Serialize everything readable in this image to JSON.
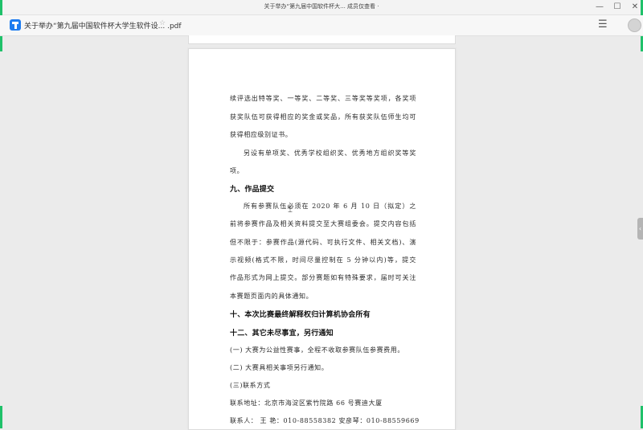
{
  "window": {
    "title": "关于举办“第九届中国软件杯大... 成员仅查看 ·",
    "controls": {
      "minimize": "—",
      "maximize": "☐",
      "close": "✕"
    }
  },
  "tab": {
    "doc_title": "关于举办“第九届中国软件杯大学生软件设... .pdf",
    "star": "☆",
    "menu": "☰"
  },
  "document": {
    "lines": [
      "续评选出特等奖、一等奖、二等奖、三等奖等奖项，各奖项",
      "获奖队伍可获得相应的奖金或奖品，所有获奖队伍师生均可",
      "获得相应级别证书。",
      "另设有单项奖、优秀学校组织奖、优秀地方组织奖等奖",
      "项。",
      "九、作品提交",
      "所有参赛队伍必须在 2020 年 6 月 10 日（拟定）之",
      "前将参赛作品及相关资料提交至大赛组委会。提交内容包括",
      "但不限于：参赛作品(源代码、可执行文件、相关文档)、演",
      "示视频(格式不限，时间尽量控制在 5 分钟以内)等，提交",
      "作品形式为网上提交。部分赛题如有特殊要求，届时可关注",
      "本赛题页面内的具体通知。",
      "十、本次比赛最终解释权归计算机协会所有",
      "十二、其它未尽事宜，另行通知",
      "(一) 大赛为公益性赛事，全程不收取参赛队伍参赛费用。",
      "(二) 大赛具相关事项另行通知。",
      "(三)联系方式",
      "联系地址：北京市海淀区紫竹院路 66 号赛迪大厦",
      "联系人：  王  艳：010-88558382  安彦琴：010-88559669"
    ]
  },
  "side_tab": {
    "glyph": "‹"
  }
}
